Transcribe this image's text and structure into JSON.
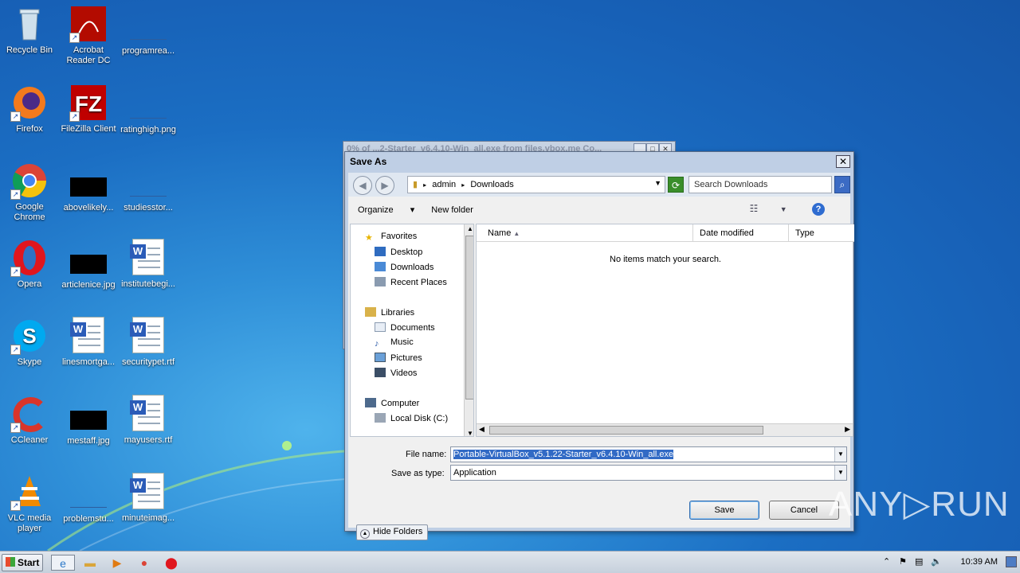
{
  "desktop": {
    "icons": [
      {
        "label": "Recycle Bin"
      },
      {
        "label": "Acrobat Reader DC"
      },
      {
        "label": "programrea..."
      },
      {
        "label": "Firefox"
      },
      {
        "label": "FileZilla Client"
      },
      {
        "label": "ratinghigh.png"
      },
      {
        "label": "Google Chrome"
      },
      {
        "label": "abovelikely..."
      },
      {
        "label": "studiesstor..."
      },
      {
        "label": "Opera"
      },
      {
        "label": "articlenice.jpg"
      },
      {
        "label": "institutebegi..."
      },
      {
        "label": "Skype"
      },
      {
        "label": "linesmortga..."
      },
      {
        "label": "securitypet.rtf"
      },
      {
        "label": "CCleaner"
      },
      {
        "label": "mestaff.jpg"
      },
      {
        "label": "mayusers.rtf"
      },
      {
        "label": "VLC media player"
      },
      {
        "label": "problemstu..."
      },
      {
        "label": "minuteimag..."
      }
    ]
  },
  "background_window": {
    "title": "0% of ...2-Starter_v6.4.10-Win_all.exe from files.vbox.me Co..."
  },
  "dialog": {
    "title": "Save As",
    "breadcrumb": [
      "admin",
      "Downloads"
    ],
    "search_placeholder": "Search Downloads",
    "toolbar": {
      "organize": "Organize",
      "new_folder": "New folder"
    },
    "nav": {
      "favorites": "Favorites",
      "desktop": "Desktop",
      "downloads": "Downloads",
      "recent_places": "Recent Places",
      "libraries": "Libraries",
      "documents": "Documents",
      "music": "Music",
      "pictures": "Pictures",
      "videos": "Videos",
      "computer": "Computer",
      "local_disk": "Local Disk (C:)"
    },
    "columns": {
      "name": "Name",
      "date_modified": "Date modified",
      "type": "Type"
    },
    "empty_message": "No items match your search.",
    "file_name_label": "File name:",
    "file_name_value": "Portable-VirtualBox_v5.1.22-Starter_v6.4.10-Win_all.exe",
    "save_as_type_label": "Save as type:",
    "save_as_type_value": "Application",
    "hide_folders": "Hide Folders",
    "save": "Save",
    "cancel": "Cancel"
  },
  "watermark": "ANY▷RUN",
  "taskbar": {
    "start": "Start",
    "clock": "10:39 AM"
  }
}
